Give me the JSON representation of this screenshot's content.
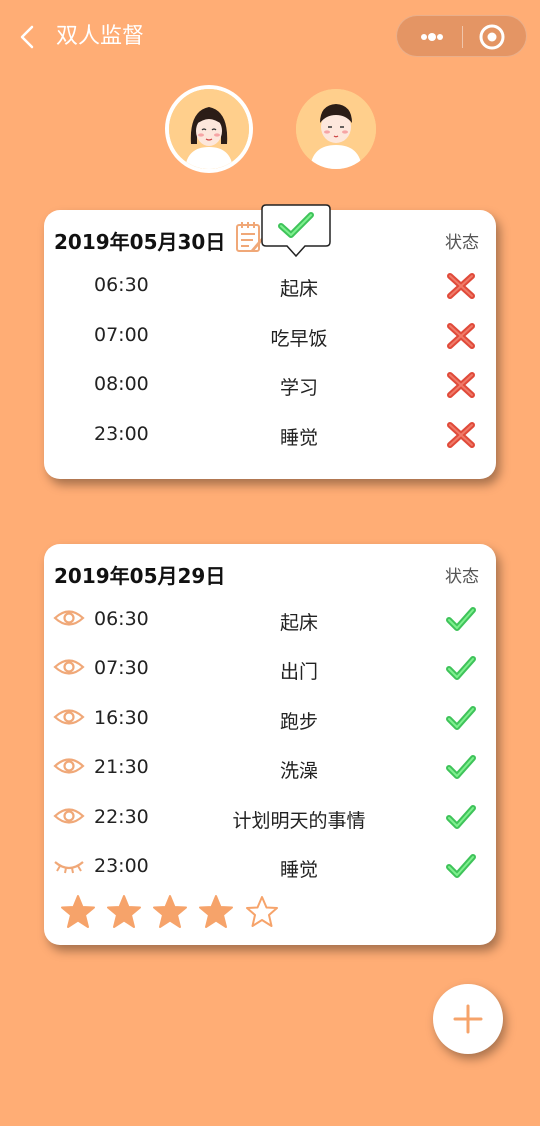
{
  "header": {
    "title": "双人监督"
  },
  "colors": {
    "background": "#ffad75",
    "accent": "#f0a878",
    "check": "#4cd964",
    "cross": "#e04a3a"
  },
  "avatars": [
    {
      "name": "female-avatar",
      "selected": true
    },
    {
      "name": "male-avatar",
      "selected": false
    }
  ],
  "cards": [
    {
      "date": "2019年05月30日",
      "status_label": "状态",
      "items": [
        {
          "time": "06:30",
          "task": "起床",
          "status": "cross-icon"
        },
        {
          "time": "07:00",
          "task": "吃早饭",
          "status": "cross-icon"
        },
        {
          "time": "08:00",
          "task": "学习",
          "status": "cross-icon"
        },
        {
          "time": "23:00",
          "task": "睡觉",
          "status": "cross-icon"
        }
      ]
    },
    {
      "date": "2019年05月29日",
      "status_label": "状态",
      "items": [
        {
          "time": "06:30",
          "task": "起床",
          "status": "check-icon",
          "eye": "eye-open-icon"
        },
        {
          "time": "07:30",
          "task": "出门",
          "status": "check-icon",
          "eye": "eye-open-icon"
        },
        {
          "time": "16:30",
          "task": "跑步",
          "status": "check-icon",
          "eye": "eye-open-icon"
        },
        {
          "time": "21:30",
          "task": "洗澡",
          "status": "check-icon",
          "eye": "eye-open-icon"
        },
        {
          "time": "22:30",
          "task": "计划明天的事情",
          "status": "check-icon",
          "eye": "eye-open-icon"
        },
        {
          "time": "23:00",
          "task": "睡觉",
          "status": "check-icon",
          "eye": "eye-closed-icon"
        }
      ],
      "rating": {
        "value": 4,
        "max": 5
      }
    }
  ]
}
